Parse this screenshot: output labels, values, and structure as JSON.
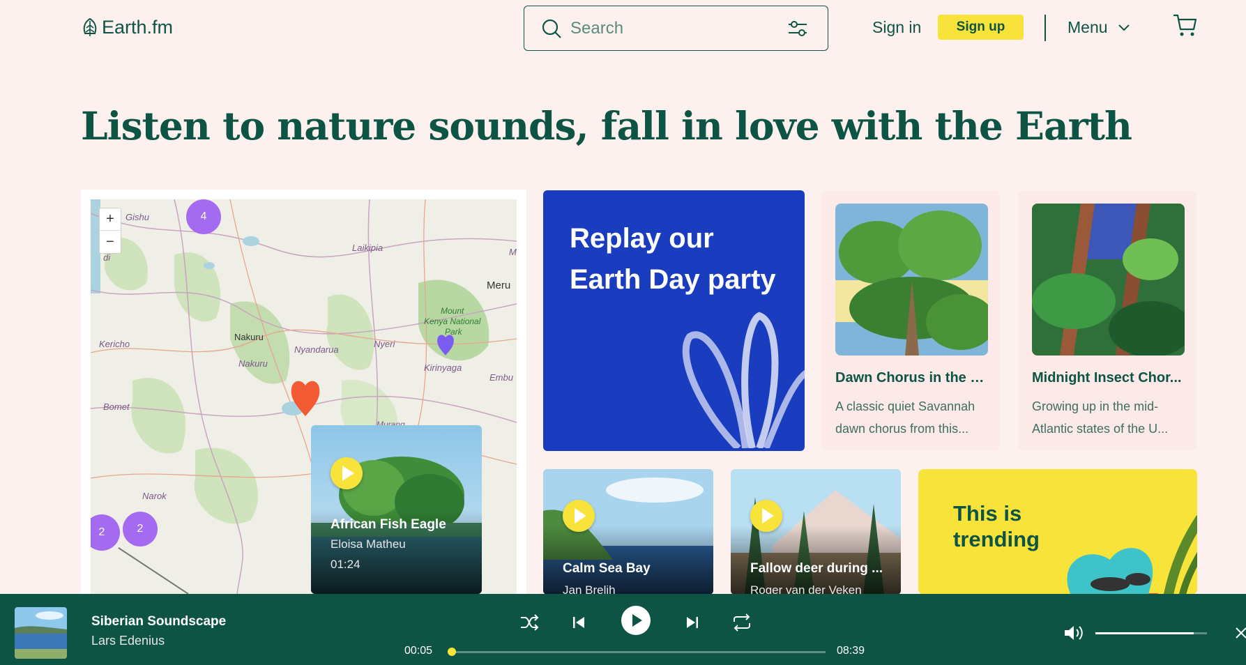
{
  "header": {
    "logo_text": "Earth.fm",
    "search_placeholder": "Search",
    "signin_label": "Sign in",
    "signup_label": "Sign up",
    "menu_label": "Menu"
  },
  "hero": {
    "title": "Listen to nature sounds, fall in love with the Earth"
  },
  "map": {
    "zoom_in": "+",
    "zoom_out": "−",
    "clusters": [
      "4",
      "2",
      "2"
    ],
    "places": {
      "gishu": "Gishu",
      "di": "di",
      "laikipia": "Laikipia",
      "m": "M",
      "meru": "Meru",
      "kericho": "Kericho",
      "nakuru_town": "Nakuru",
      "nakuru": "Nakuru",
      "nyandarua": "Nyandarua",
      "nyeri": "Nyeri",
      "mtkenya1": "Mount",
      "mtkenya2": "Kenya National",
      "mtkenya3": "Park",
      "kirinyaga": "Kirinyaga",
      "embu": "Embu",
      "bomet": "Bomet",
      "narok": "Narok",
      "murang": "Murang"
    },
    "popup": {
      "title": "African Fish Eagle",
      "artist": "Eloisa Matheu",
      "duration": "01:24"
    }
  },
  "promo": {
    "line1": "Replay our",
    "line2": "Earth Day party"
  },
  "featured": [
    {
      "title": "Dawn Chorus in the S...",
      "desc1": "A classic quiet Savannah",
      "desc2": "dawn chorus from this..."
    },
    {
      "title": "Midnight Insect Chor...",
      "desc1": "Growing up in the mid-",
      "desc2": "Atlantic states of the U..."
    }
  ],
  "tracks": [
    {
      "title": "Calm Sea Bay",
      "artist": "Jan Brelih"
    },
    {
      "title": "Fallow deer during ...",
      "artist": "Roger van der Veken"
    }
  ],
  "trending": {
    "line1": "This is",
    "line2": "trending"
  },
  "player": {
    "title": "Siberian Soundscape",
    "artist": "Lars Edenius",
    "elapsed": "00:05",
    "total": "08:39",
    "progress": 0.01,
    "volume": 0.88
  },
  "colors": {
    "brand": "#0d5444",
    "accent": "#f7e33a",
    "promo": "#1a3dc0",
    "cluster": "#a46af0"
  }
}
